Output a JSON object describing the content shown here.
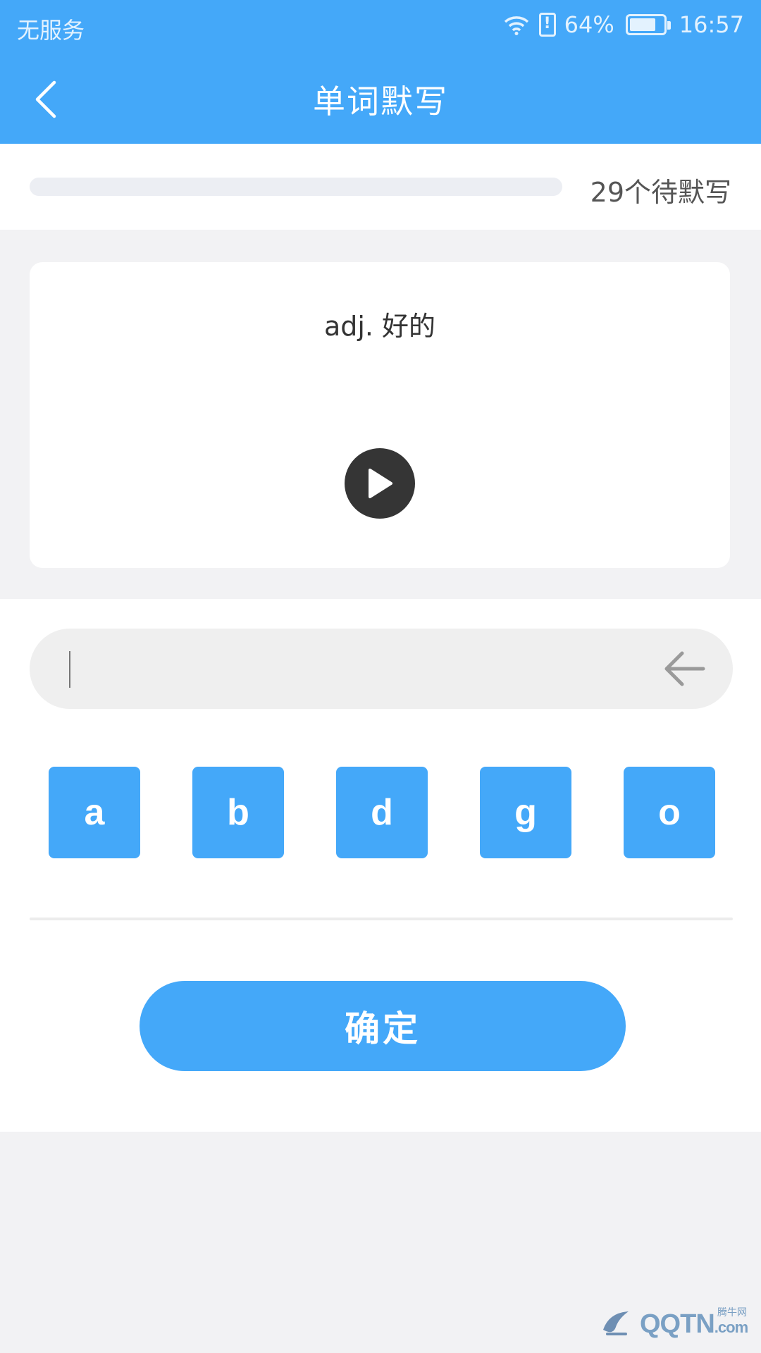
{
  "status_bar": {
    "carrier": "无服务",
    "battery": "64%",
    "time": "16:57"
  },
  "header": {
    "title": "单词默写",
    "back_icon": "chevron-left-icon"
  },
  "progress": {
    "fraction": 0.0,
    "remaining_label": "29个待默写"
  },
  "word_card": {
    "meaning": "adj. 好的",
    "play_icon": "play-icon"
  },
  "answer": {
    "value": "",
    "delete_icon": "arrow-left-icon"
  },
  "letters": [
    "a",
    "b",
    "d",
    "g",
    "o"
  ],
  "confirm_label": "确定",
  "watermark": {
    "brand": "QQTN",
    "suffix": ".com",
    "sub": "腾牛网"
  },
  "colors": {
    "accent": "#44a8f9",
    "play_button": "#353535",
    "background": "#f2f2f4"
  }
}
